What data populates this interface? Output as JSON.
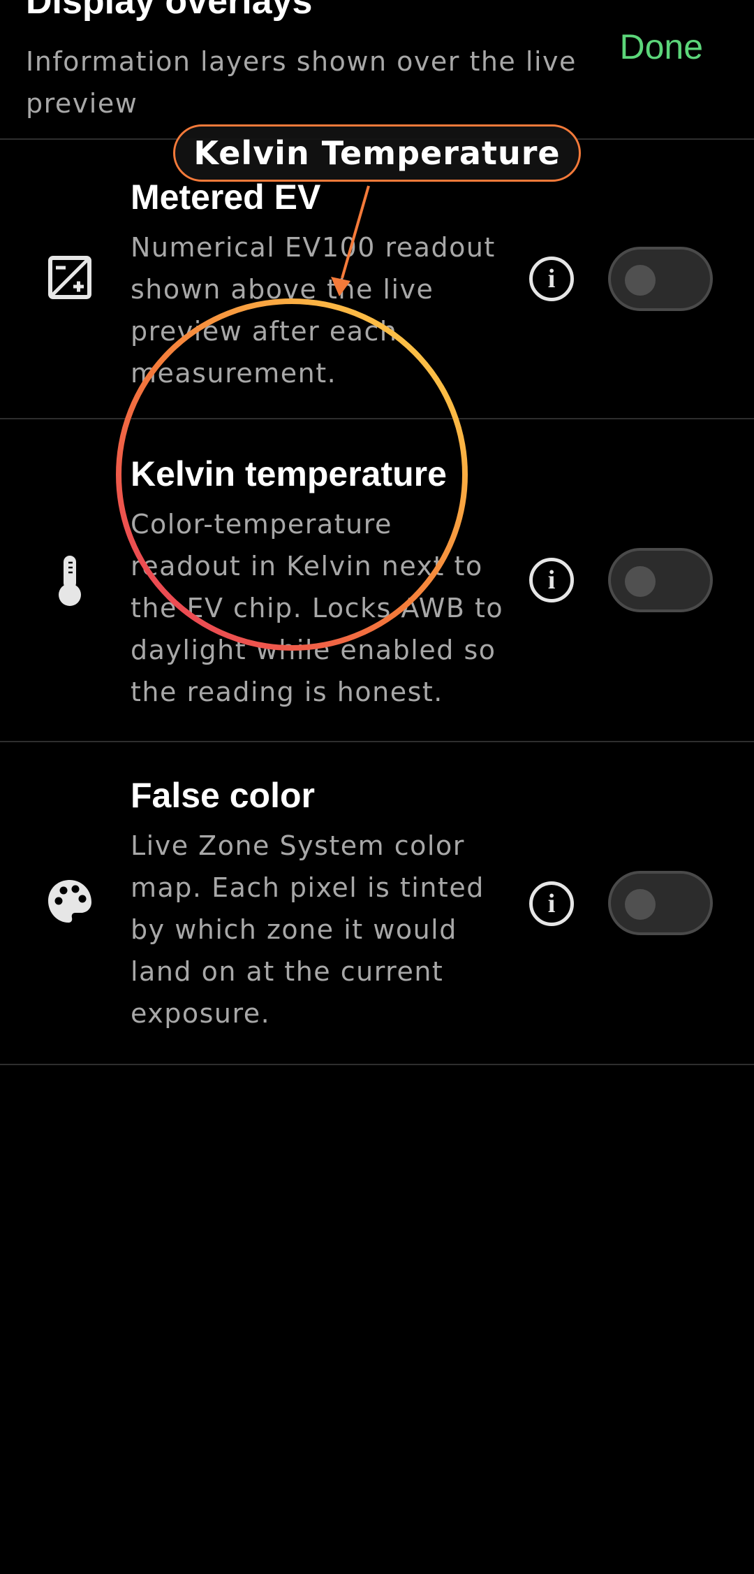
{
  "header": {
    "title": "Display overlays",
    "subtitle": "Information layers shown over the live preview",
    "done_label": "Done"
  },
  "rows": [
    {
      "title": "Metered EV",
      "description": "Numerical EV100 readout shown above the live preview after each measurement.",
      "icon": "exposure-icon",
      "enabled": false
    },
    {
      "title": "Kelvin temperature",
      "description": "Color-temperature readout in Kelvin next to the EV chip. Locks AWB to daylight while enabled so the reading is honest.",
      "icon": "thermometer-icon",
      "enabled": false
    },
    {
      "title": "False color",
      "description": "Live Zone System color map. Each pixel is tinted by which zone it would land on at the current exposure.",
      "icon": "palette-icon",
      "enabled": false
    }
  ],
  "annotation": {
    "label": "Kelvin Temperature",
    "border_color": "#f47a3a",
    "ring_colors": [
      "#ffd84a",
      "#f4793a",
      "#e8365e"
    ]
  },
  "colors": {
    "accent": "#5cd67a",
    "background": "#000000",
    "secondary_text": "#a8a8a8"
  }
}
